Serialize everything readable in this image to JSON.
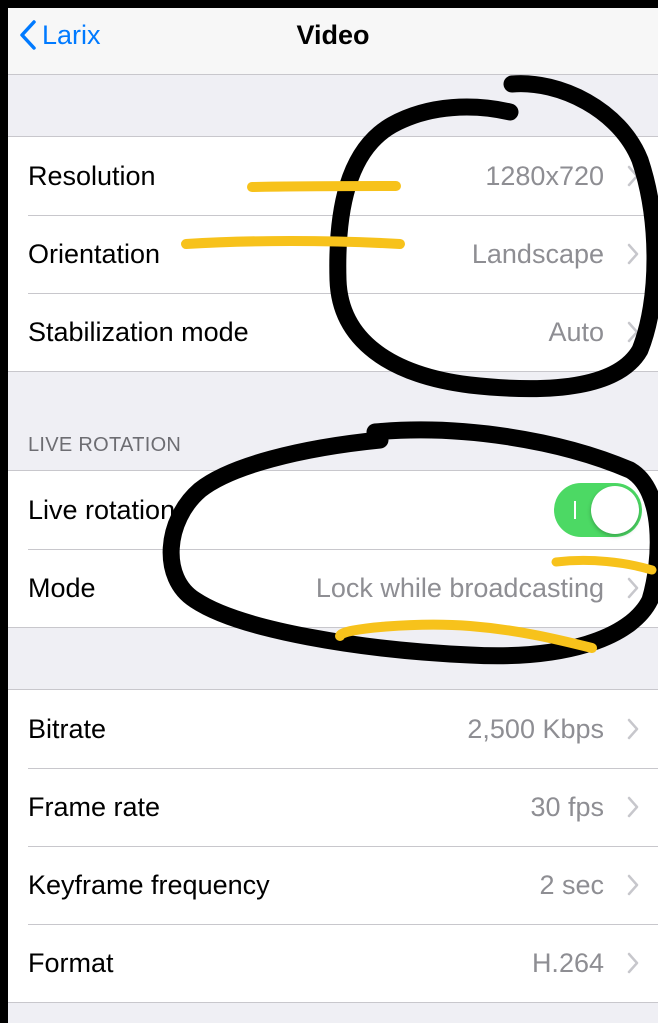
{
  "navbar": {
    "back_label": "Larix",
    "title": "Video"
  },
  "groups": {
    "video": [
      {
        "label": "Resolution",
        "value": "1280x720"
      },
      {
        "label": "Orientation",
        "value": "Landscape"
      },
      {
        "label": "Stabilization mode",
        "value": "Auto"
      }
    ],
    "live_rotation": {
      "header": "LIVE ROTATION",
      "toggle_label": "Live rotation",
      "toggle_on": true,
      "mode_label": "Mode",
      "mode_value": "Lock while broadcasting"
    },
    "encoding": [
      {
        "label": "Bitrate",
        "value": "2,500 Kbps"
      },
      {
        "label": "Frame rate",
        "value": "30 fps"
      },
      {
        "label": "Keyframe frequency",
        "value": "2 sec"
      },
      {
        "label": "Format",
        "value": "H.264"
      }
    ]
  },
  "colors": {
    "accent": "#007aff",
    "toggle_on": "#4cd964",
    "value_text": "#8e8e93",
    "scribble_black": "#000000",
    "scribble_yellow": "#f7c21b"
  }
}
